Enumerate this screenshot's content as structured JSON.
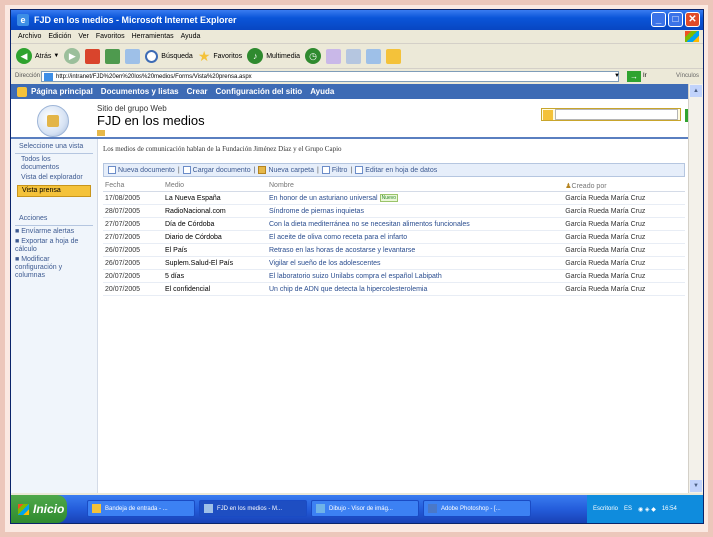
{
  "window": {
    "title": "FJD en los medios - Microsoft Internet Explorer"
  },
  "menu": [
    "Archivo",
    "Edición",
    "Ver",
    "Favoritos",
    "Herramientas",
    "Ayuda"
  ],
  "toolbar": {
    "back": "Atrás",
    "search": "Búsqueda",
    "favorites": "Favoritos",
    "multimedia": "Multimedia"
  },
  "address": {
    "label": "Dirección",
    "url": "http://intranet/FJD%20en%20los%20medios/Forms/Vista%20prensa.aspx",
    "go": "Ir",
    "links": "Vínculos"
  },
  "topnav": [
    "Página principal",
    "Documentos y listas",
    "Crear",
    "Configuración del sitio",
    "Ayuda"
  ],
  "site": {
    "subtitle": "Sitio del grupo Web",
    "title": "FJD en los medios"
  },
  "leftnav": {
    "select_view": "Seleccione una vista",
    "views": [
      "Todos los documentos",
      "Vista del explorador"
    ],
    "active_view": "Vista prensa",
    "actions_heading": "Acciones",
    "actions": [
      "Envíarme alertas",
      "Exportar a hoja de cálculo",
      "Modificar configuración y columnas"
    ]
  },
  "description": "Los medios de comunicación hablan de la Fundación Jiménez Díaz y el Grupo Capio",
  "actionbar": [
    "Nueva documento",
    "Cargar documento",
    "Nueva carpeta",
    "Filtro",
    "Editar en hoja de datos"
  ],
  "table": {
    "headers": [
      "Fecha",
      "Medio",
      "Nombre",
      "Creado por"
    ],
    "new_badge": "Nuevo",
    "rows": [
      {
        "date": "17/08/2005",
        "medio": "La Nueva España",
        "nombre": "En honor de un asturiano universal",
        "author": "García Rueda María Cruz"
      },
      {
        "date": "28/07/2005",
        "medio": "RadioNacional.com",
        "nombre": "Síndrome de piernas inquietas",
        "author": "García Rueda María Cruz"
      },
      {
        "date": "27/07/2005",
        "medio": "Día de Córdoba",
        "nombre": "Con la dieta mediterránea no se necesitan alimentos funcionales",
        "author": "García Rueda María Cruz"
      },
      {
        "date": "27/07/2005",
        "medio": "Diario de Córdoba",
        "nombre": "El aceite de oliva como receta para el infarto",
        "author": "García Rueda María Cruz"
      },
      {
        "date": "26/07/2005",
        "medio": "El País",
        "nombre": "Retraso en las horas de acostarse y levantarse",
        "author": "García Rueda María Cruz"
      },
      {
        "date": "26/07/2005",
        "medio": "Suplem.Salud-El País",
        "nombre": "Vigilar el sueño de los adolescentes",
        "author": "García Rueda María Cruz"
      },
      {
        "date": "20/07/2005",
        "medio": "5 días",
        "nombre": "El laboratorio suizo Unilabs compra el español Labipath",
        "author": "García Rueda María Cruz"
      },
      {
        "date": "20/07/2005",
        "medio": "El confidencial",
        "nombre": "Un chip de ADN que detecta la hipercolesterolemia",
        "author": "García Rueda María Cruz"
      }
    ]
  },
  "taskbar": {
    "start": "Inicio",
    "tasks": [
      "Bandeja de entrada - ...",
      "FJD en los medios - M...",
      "Dibujo - Visor de imág...",
      "Adobe Photoshop - [..."
    ],
    "tray": {
      "desktop": "Escritorio",
      "lang": "ES",
      "time": "16:54"
    }
  }
}
